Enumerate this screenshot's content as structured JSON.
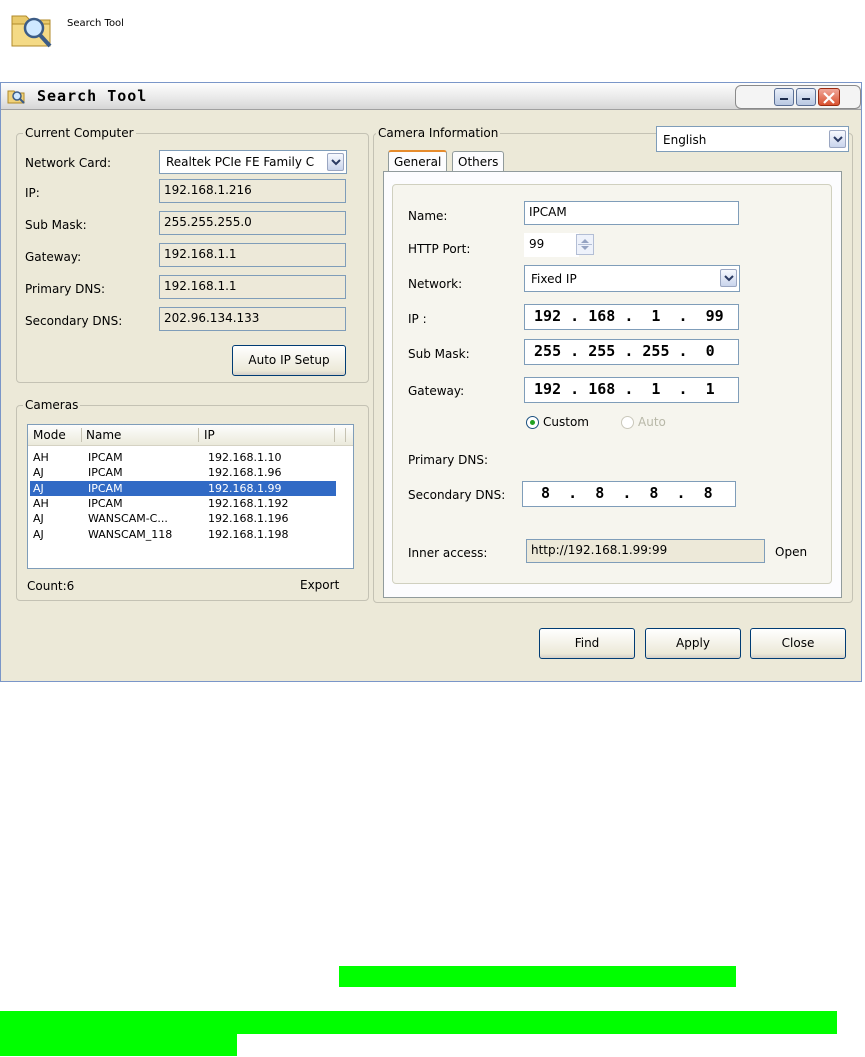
{
  "desktop": {
    "icon_label": "Search Tool"
  },
  "window": {
    "title": "Search Tool"
  },
  "current_computer": {
    "group_title": "Current Computer",
    "network_card_label": "Network Card:",
    "network_card_value": "Realtek PCIe FE Family C",
    "ip_label": "IP:",
    "ip_value": "192.168.1.216",
    "submask_label": "Sub Mask:",
    "submask_value": "255.255.255.0",
    "gateway_label": "Gateway:",
    "gateway_value": "192.168.1.1",
    "primary_dns_label": "Primary DNS:",
    "primary_dns_value": "192.168.1.1",
    "secondary_dns_label": "Secondary DNS:",
    "secondary_dns_value": "202.96.134.133",
    "auto_ip_button": "Auto IP Setup"
  },
  "cameras": {
    "group_title": "Cameras",
    "columns": [
      "Mode",
      "Name",
      "IP"
    ],
    "rows": [
      {
        "mode": "AH",
        "name": "IPCAM",
        "ip": "192.168.1.10"
      },
      {
        "mode": "AJ",
        "name": "IPCAM",
        "ip": "192.168.1.96"
      },
      {
        "mode": "AJ",
        "name": "IPCAM",
        "ip": "192.168.1.99"
      },
      {
        "mode": "AH",
        "name": "IPCAM",
        "ip": "192.168.1.192"
      },
      {
        "mode": "AJ",
        "name": "WANSCAM-C...",
        "ip": "192.168.1.196"
      },
      {
        "mode": "AJ",
        "name": "WANSCAM_118",
        "ip": "192.168.1.198"
      }
    ],
    "count_label": "Count:6",
    "export_label": "Export"
  },
  "camera_info": {
    "group_title": "Camera Information",
    "language": "English",
    "tabs": [
      "General",
      "Others"
    ],
    "name_label": "Name:",
    "name_value": "IPCAM",
    "http_port_label": "HTTP Port:",
    "http_port_value": "99",
    "network_label": "Network:",
    "network_value": "Fixed IP",
    "ip_label": "IP :",
    "ip_value": " 192 . 168 .  1  .  99",
    "submask_label": "Sub Mask:",
    "submask_value": " 255 . 255 . 255 .  0",
    "gateway_label": "Gateway:",
    "gateway_value": " 192 . 168 .  1  .  1",
    "radio_custom": "Custom",
    "radio_auto": "Auto",
    "primary_dns_label": "Primary DNS:",
    "secondary_dns_label": "Secondary DNS:",
    "secondary_dns_value": "  8  .  8  .  8  .  8",
    "inner_access_label": "Inner access:",
    "inner_access_value": "http://192.168.1.99:99",
    "open_label": "Open"
  },
  "footer": {
    "find": "Find",
    "apply": "Apply",
    "close": "Close"
  },
  "colors": {
    "selection": "#316ac5",
    "highlight": "#00ff00",
    "window_bg": "#ece9d8"
  }
}
